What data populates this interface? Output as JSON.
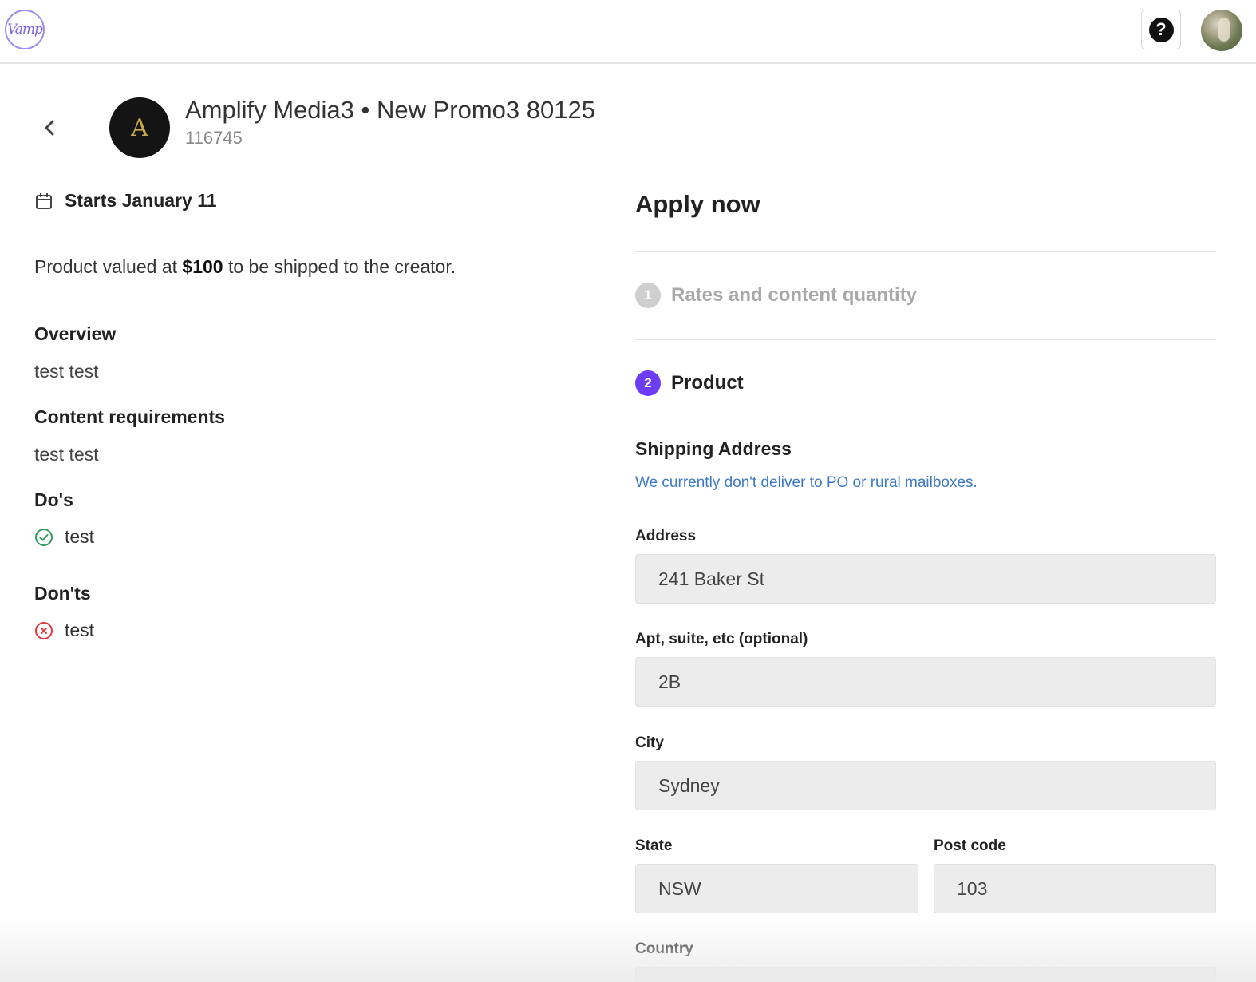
{
  "header": {
    "logo_text": "Vamp",
    "help_label": "?",
    "icons": {
      "logo": "vamp-logo",
      "help": "question-circle-icon",
      "avatar": "user-avatar"
    }
  },
  "campaign": {
    "title": "Amplify Media3 • New Promo3 80125",
    "id": "116745",
    "brand_logo_glyph": "A",
    "starts": "Starts January 11",
    "valued_prefix": "Product valued at ",
    "valued_amount": "$100",
    "valued_suffix": " to be shipped to the creator.",
    "overview_heading": "Overview",
    "overview_text": "test test",
    "requirements_heading": "Content requirements",
    "requirements_text": "test test",
    "dos_heading": "Do's",
    "dos": [
      "test"
    ],
    "donts_heading": "Don'ts",
    "donts": [
      "test"
    ]
  },
  "apply": {
    "heading": "Apply now",
    "steps": [
      {
        "number": "1",
        "label": "Rates and content quantity",
        "state": "done"
      },
      {
        "number": "2",
        "label": "Product",
        "state": "active"
      }
    ],
    "shipping_heading": "Shipping Address",
    "shipping_note": "We currently don't deliver to PO or rural mailboxes.",
    "fields": {
      "address": {
        "label": "Address",
        "value": "241 Baker St"
      },
      "apt": {
        "label": "Apt, suite, etc (optional)",
        "value": "2B"
      },
      "city": {
        "label": "City",
        "value": "Sydney"
      },
      "state": {
        "label": "State",
        "value": "NSW"
      },
      "postcode": {
        "label": "Post code",
        "value": "103"
      },
      "country": {
        "label": "Country",
        "value": ""
      }
    }
  },
  "colors": {
    "accent": "#6d3df5",
    "link": "#3d79c4",
    "success": "#2e9e5b",
    "error": "#e0393e"
  }
}
